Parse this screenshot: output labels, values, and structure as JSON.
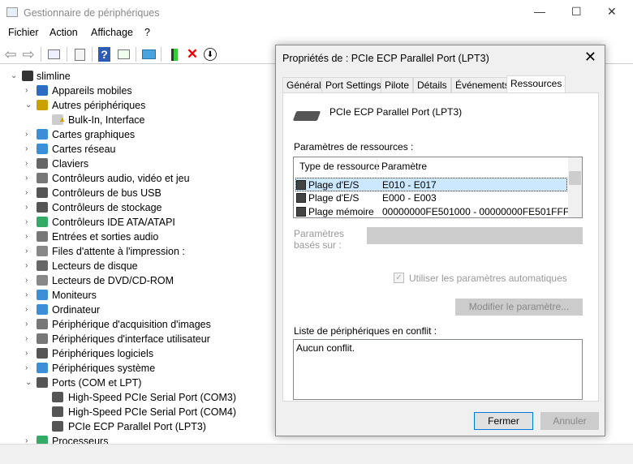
{
  "window": {
    "title": "Gestionnaire de périphériques",
    "minimize": "—",
    "maximize": "☐",
    "close": "✕"
  },
  "menu": [
    "Fichier",
    "Action",
    "Affichage",
    "?"
  ],
  "toolbar": {
    "back": "⇦",
    "forward": "⇨",
    "help": "?",
    "uninstall": "✕",
    "update": "⬇"
  },
  "tree": {
    "root": "slimline",
    "categories": [
      "Appareils mobiles",
      "Autres périphériques",
      "Cartes graphiques",
      "Cartes réseau",
      "Claviers",
      "Contrôleurs audio, vidéo et jeu",
      "Contrôleurs de bus USB",
      "Contrôleurs de stockage",
      "Contrôleurs IDE ATA/ATAPI",
      "Entrées et sorties audio",
      "Files d'attente à l'impression :",
      "Lecteurs de disque",
      "Lecteurs de DVD/CD-ROM",
      "Moniteurs",
      "Ordinateur",
      "Périphérique d'acquisition d'images",
      "Périphériques d'interface utilisateur",
      "Périphériques logiciels",
      "Périphériques système",
      "Ports (COM et LPT)",
      "Processeurs"
    ],
    "other_children": [
      "Bulk-In, Interface"
    ],
    "ports_children": [
      "High-Speed PCIe Serial Port (COM3)",
      "High-Speed PCIe Serial Port (COM4)",
      "PCIe ECP Parallel Port (LPT3)"
    ]
  },
  "dialog": {
    "title": "Propriétés de : PCIe ECP Parallel Port (LPT3)",
    "close": "✕",
    "tabs": [
      "Général",
      "Port Settings",
      "Pilote",
      "Détails",
      "Événements",
      "Ressources"
    ],
    "active_tab": "Ressources",
    "device_name": "PCIe ECP Parallel Port (LPT3)",
    "resources_label": "Paramètres de ressources :",
    "columns": [
      "Type de ressource",
      "Paramètre"
    ],
    "rows": [
      {
        "type": "Plage d'E/S",
        "value": "E010 - E017"
      },
      {
        "type": "Plage d'E/S",
        "value": "E000 - E003"
      },
      {
        "type": "Plage mémoire",
        "value": "00000000FE501000 - 00000000FE501FFF"
      }
    ],
    "based_on_label": "Paramètres basés sur :",
    "auto_checkbox": "Utiliser les paramètres automatiques",
    "modify_button": "Modifier le paramètre...",
    "conflict_label": "Liste de périphériques en conflit :",
    "conflict_text": "Aucun conflit.",
    "ok_button": "Fermer",
    "cancel_button": "Annuler"
  }
}
